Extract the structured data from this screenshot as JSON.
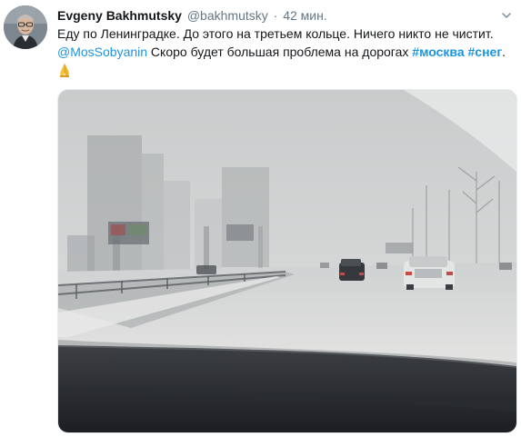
{
  "tweet": {
    "author": {
      "fullname": "Evgeny Bakhmutsky",
      "handle": "@bakhmutsky",
      "separator": "·",
      "time": "42 мин."
    },
    "text": {
      "line1": "Еду по Ленинградке. До этого на третьем кольце. Ничего никто не чистит.",
      "mention": "@MosSobyanin",
      "line2_body": " Скоро будет большая проблема на дорогах ",
      "hashtag1": "#москва",
      "space": " ",
      "hashtag2": "#снег",
      "period": ".",
      "emoji": "folded-hands-emoji"
    },
    "media": {
      "icon": "snowy-highway-photo"
    },
    "icons": {
      "caret": "chevron-down-icon"
    },
    "colors": {
      "link": "#1b95e0",
      "secondary_text": "#657786",
      "primary_text": "#14171a"
    }
  }
}
